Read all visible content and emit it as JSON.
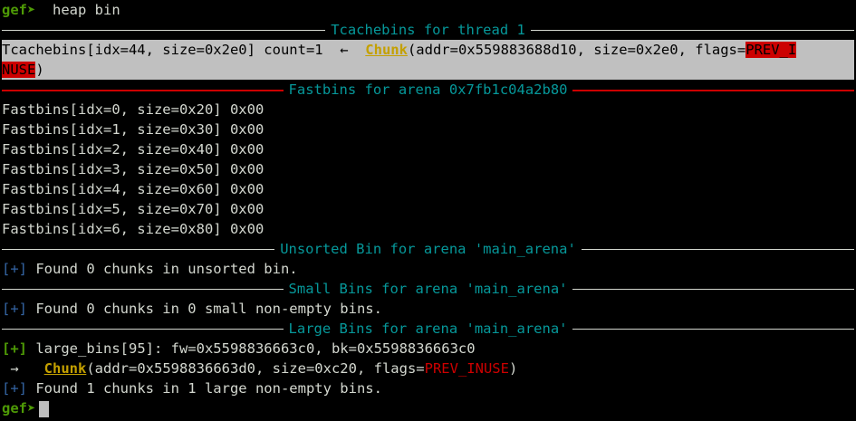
{
  "prompt": {
    "label": "gef➤",
    "command": "  heap bin"
  },
  "tcache": {
    "header": "Tcachebins for thread 1",
    "line1_prefix": "Tcachebins[idx=44, size=0x2e0] count=1  ←  ",
    "chunk_label": "Chunk",
    "line1_mid": "(addr=0x559883688d10, size=0x2e0, flags=",
    "flag_part1": "PREV_I",
    "flag_part2": "NUSE",
    "line2_suffix": ")"
  },
  "fastbins": {
    "header": "Fastbins for arena 0x7fb1c04a2b80",
    "rows": [
      "Fastbins[idx=0, size=0x20] 0x00",
      "Fastbins[idx=1, size=0x30] 0x00",
      "Fastbins[idx=2, size=0x40] 0x00",
      "Fastbins[idx=3, size=0x50] 0x00",
      "Fastbins[idx=4, size=0x60] 0x00",
      "Fastbins[idx=5, size=0x70] 0x00",
      "Fastbins[idx=6, size=0x80] 0x00"
    ]
  },
  "unsorted": {
    "header": "Unsorted Bin for arena 'main_arena'",
    "marker": "[+]",
    "text": " Found 0 chunks in unsorted bin."
  },
  "small": {
    "header": "Small Bins for arena 'main_arena'",
    "marker": "[+]",
    "text": " Found 0 chunks in 0 small non-empty bins."
  },
  "large": {
    "header": "Large Bins for arena 'main_arena'",
    "marker1": "[+]",
    "bins_line": " large_bins[95]: fw=0x5598836663c0, bk=0x5598836663c0",
    "arrow": " →   ",
    "chunk_label": "Chunk",
    "chunk_mid": "(addr=0x5598836663d0, size=0xc20, flags=",
    "flag": "PREV_INUSE",
    "chunk_end": ")",
    "marker2": "[+]",
    "found": " Found 1 chunks in 1 large non-empty bins."
  },
  "prompt2": {
    "label": "gef➤"
  }
}
